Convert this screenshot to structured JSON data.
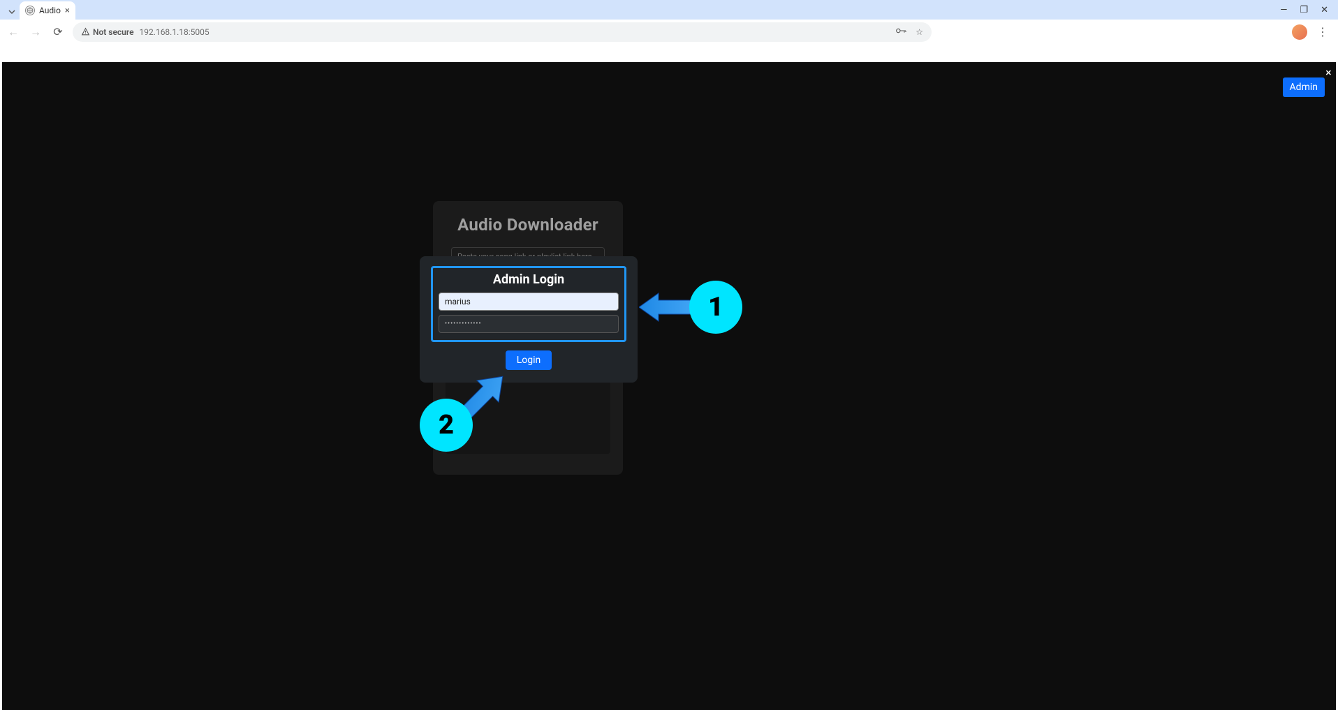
{
  "browser": {
    "tab_title": "Audio",
    "not_secure_label": "Not secure",
    "url": "192.168.1.18:5005"
  },
  "top_button": {
    "label": "Admin",
    "close_glyph": "✕"
  },
  "background_card": {
    "title": "Audio Downloader",
    "placeholder": "Paste your song link or playlist link here"
  },
  "modal": {
    "title": "Admin Login",
    "username_value": "marius",
    "password_masked": "•••••••••••••",
    "login_label": "Login"
  },
  "annotations": {
    "step1": "1",
    "step2": "2"
  }
}
